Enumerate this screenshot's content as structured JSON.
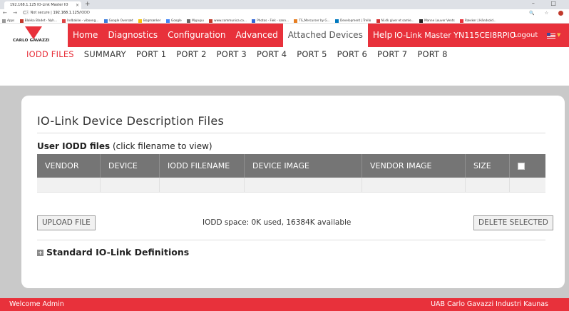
{
  "browser": {
    "tab_title": "192.168.1.125 IO-Link Master IO",
    "tab_close": "×",
    "new_tab": "+",
    "window_controls": "– □",
    "nav": "← → C",
    "security": "ⓘ Not secure",
    "url_host": "192.168.1.125",
    "url_path": "/IODD",
    "omni_icons": "🔍 ☆",
    "bookmarks": [
      "Apps",
      "Blokka Bladet - Nyh...",
      "Indbakke - viboeng...",
      "Google Oversæt",
      "Bogmærker",
      "Google",
      "Mypupu",
      "www.communica.co...",
      "Photos - Fiek - sann...",
      "TS_Mercurser by G...",
      "Development | Trello",
      "Ni.dk giver et samle...",
      "Manne Louver Vents",
      "Rævker | Händsold..."
    ]
  },
  "logo": {
    "text": "CARLO GAVAZZI"
  },
  "main_menu": [
    {
      "label": "Home"
    },
    {
      "label": "Diagnostics"
    },
    {
      "label": "Configuration"
    },
    {
      "label": "Advanced"
    },
    {
      "label": "Attached Devices"
    },
    {
      "label": "Help"
    }
  ],
  "master_name": "IO-Link Master YN115CEI8RPIO",
  "logout_label": "Logout",
  "sub_menu": [
    {
      "label": "IODD FILES"
    },
    {
      "label": "SUMMARY"
    },
    {
      "label": "PORT 1"
    },
    {
      "label": "PORT 2"
    },
    {
      "label": "PORT 3"
    },
    {
      "label": "PORT 4"
    },
    {
      "label": "PORT 5"
    },
    {
      "label": "PORT 6"
    },
    {
      "label": "PORT 7"
    },
    {
      "label": "PORT 8"
    }
  ],
  "page": {
    "title": "IO-Link Device Description Files",
    "subtitle_bold": "User IODD files",
    "subtitle_rest": " (click filename to view)",
    "columns": [
      "VENDOR",
      "DEVICE",
      "IODD FILENAME",
      "DEVICE IMAGE",
      "VENDOR IMAGE",
      "SIZE"
    ],
    "upload_label": "UPLOAD FILE",
    "space_text": "IODD space: 0K used, 16384K available",
    "delete_label": "DELETE SELECTED",
    "standard_defs": "Standard IO-Link Definitions"
  },
  "footer": {
    "left": "Welcome Admin",
    "right": "UAB Carlo Gavazzi Industri Kaunas"
  },
  "colors": {
    "brand": "#e8313b",
    "header_gray": "#757575"
  }
}
